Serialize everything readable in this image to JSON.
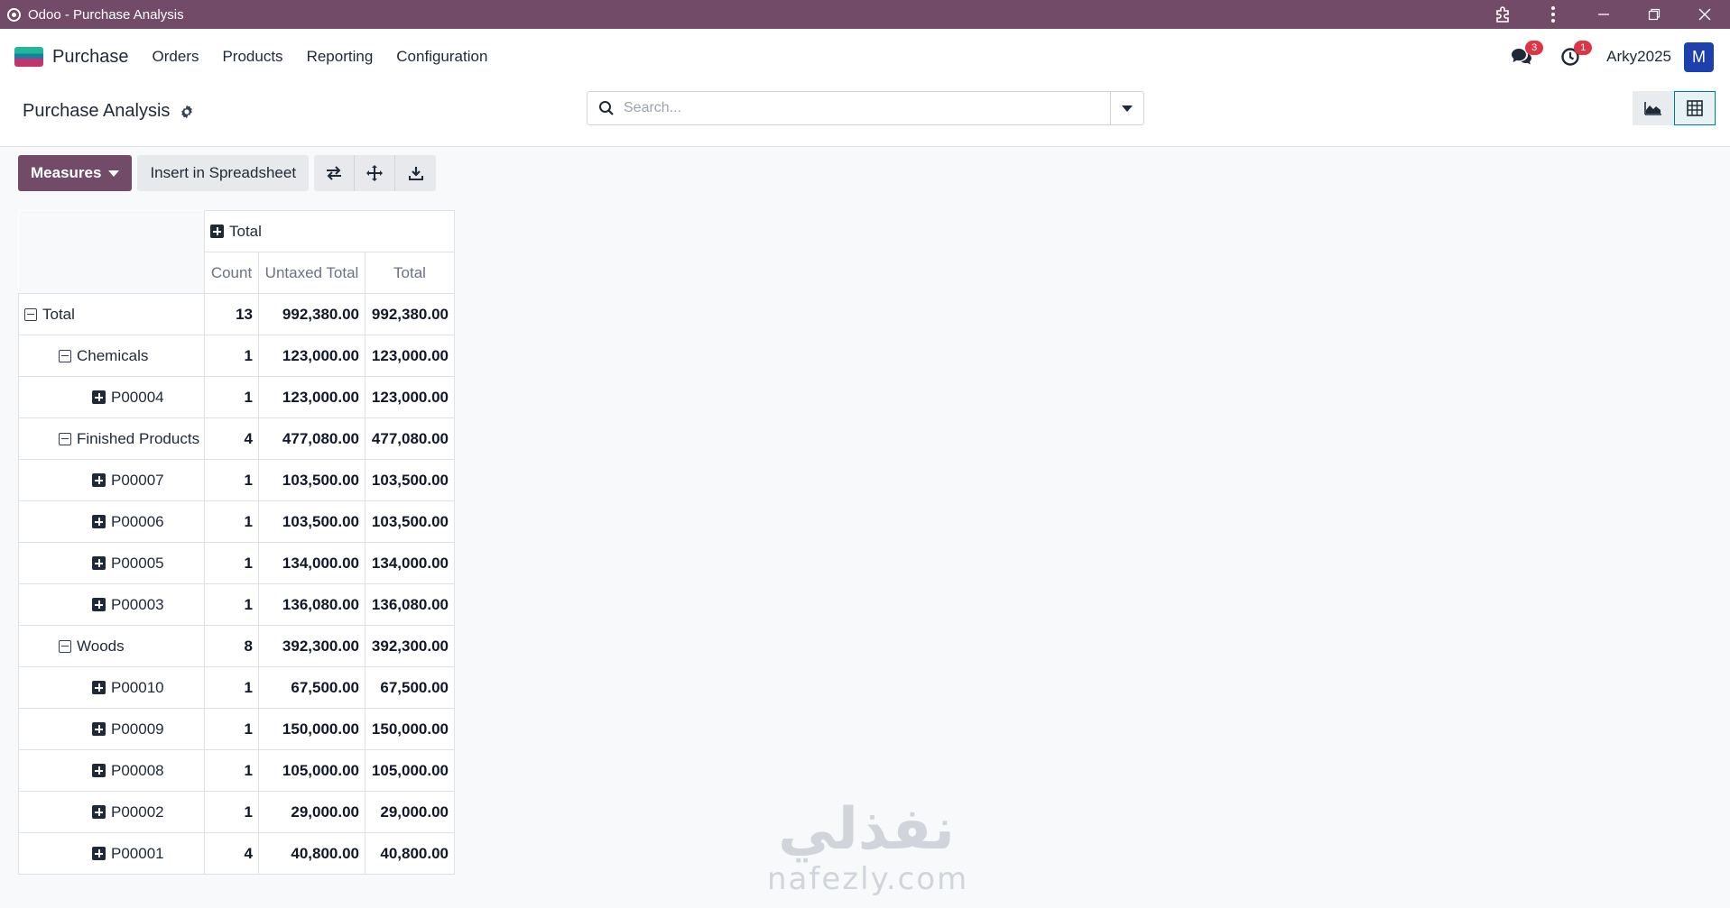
{
  "window": {
    "title": "Odoo - Purchase Analysis"
  },
  "nav": {
    "brand": "Purchase",
    "menu": [
      "Orders",
      "Products",
      "Reporting",
      "Configuration"
    ],
    "messages_badge": "3",
    "activities_badge": "1",
    "username": "Arky2025",
    "avatar_letter": "M"
  },
  "control": {
    "title": "Purchase Analysis",
    "search_placeholder": "Search..."
  },
  "toolbar": {
    "measures_label": "Measures",
    "insert_label": "Insert in Spreadsheet"
  },
  "pivot": {
    "col_header": "Total",
    "measures": [
      "Count",
      "Untaxed Total",
      "Total"
    ],
    "rows": [
      {
        "label": "Total",
        "level": 0,
        "expanded": true,
        "count": "13",
        "untaxed": "992,380.00",
        "total": "992,380.00"
      },
      {
        "label": "Chemicals",
        "level": 1,
        "expanded": true,
        "count": "1",
        "untaxed": "123,000.00",
        "total": "123,000.00"
      },
      {
        "label": "P00004",
        "level": 2,
        "expanded": false,
        "count": "1",
        "untaxed": "123,000.00",
        "total": "123,000.00"
      },
      {
        "label": "Finished Products",
        "level": 1,
        "expanded": true,
        "count": "4",
        "untaxed": "477,080.00",
        "total": "477,080.00"
      },
      {
        "label": "P00007",
        "level": 2,
        "expanded": false,
        "count": "1",
        "untaxed": "103,500.00",
        "total": "103,500.00"
      },
      {
        "label": "P00006",
        "level": 2,
        "expanded": false,
        "count": "1",
        "untaxed": "103,500.00",
        "total": "103,500.00"
      },
      {
        "label": "P00005",
        "level": 2,
        "expanded": false,
        "count": "1",
        "untaxed": "134,000.00",
        "total": "134,000.00"
      },
      {
        "label": "P00003",
        "level": 2,
        "expanded": false,
        "count": "1",
        "untaxed": "136,080.00",
        "total": "136,080.00"
      },
      {
        "label": "Woods",
        "level": 1,
        "expanded": true,
        "count": "8",
        "untaxed": "392,300.00",
        "total": "392,300.00"
      },
      {
        "label": "P00010",
        "level": 2,
        "expanded": false,
        "count": "1",
        "untaxed": "67,500.00",
        "total": "67,500.00"
      },
      {
        "label": "P00009",
        "level": 2,
        "expanded": false,
        "count": "1",
        "untaxed": "150,000.00",
        "total": "150,000.00"
      },
      {
        "label": "P00008",
        "level": 2,
        "expanded": false,
        "count": "1",
        "untaxed": "105,000.00",
        "total": "105,000.00"
      },
      {
        "label": "P00002",
        "level": 2,
        "expanded": false,
        "count": "1",
        "untaxed": "29,000.00",
        "total": "29,000.00"
      },
      {
        "label": "P00001",
        "level": 2,
        "expanded": false,
        "count": "4",
        "untaxed": "40,800.00",
        "total": "40,800.00"
      }
    ]
  },
  "watermark": {
    "arabic": "نفذلي",
    "latin": "nafezly.com"
  },
  "colors": {
    "brand": "#714b67",
    "accent": "#017e84",
    "badge": "#dc3545",
    "avatar": "#1e40af"
  }
}
